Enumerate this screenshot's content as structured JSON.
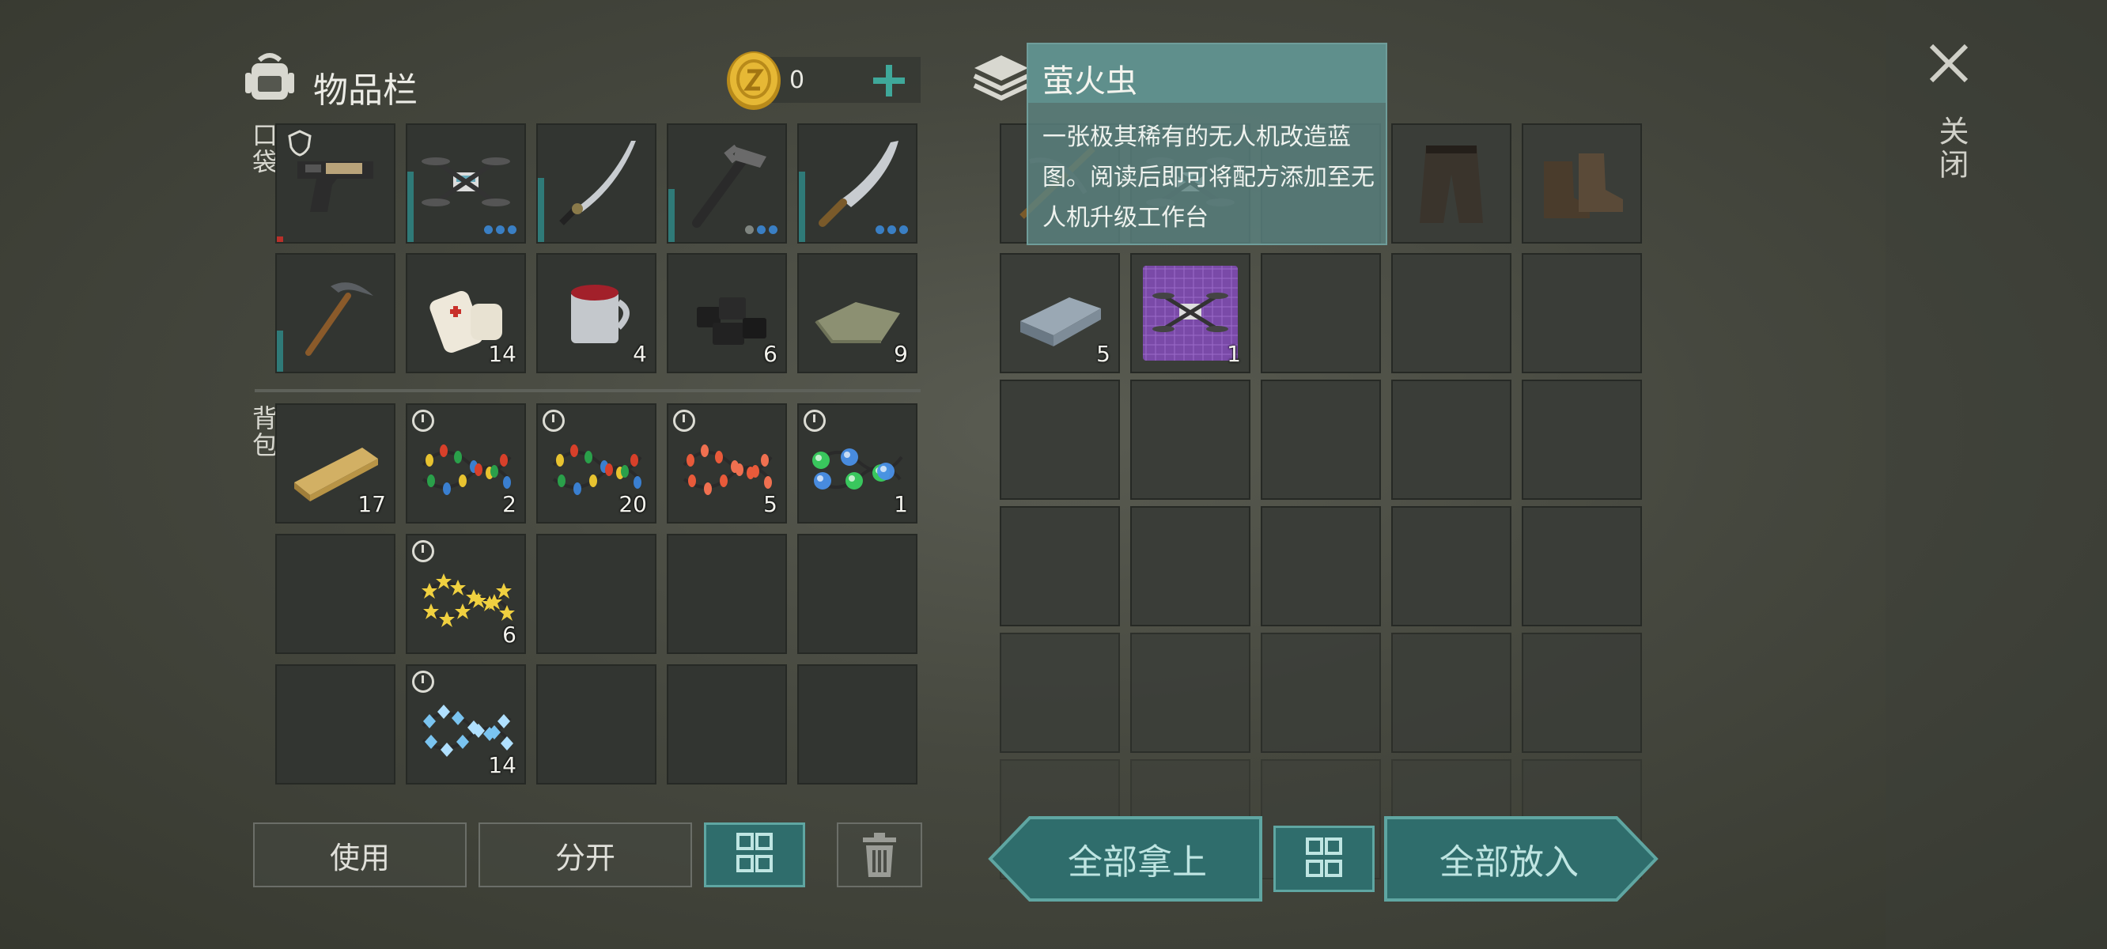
{
  "inventory": {
    "title": "物品栏",
    "coin_count": "0",
    "pocket_label": "口袋",
    "backpack_label": "背包",
    "pocket": [
      {
        "icon": "pistol-icon",
        "count": "",
        "durability": 0.05,
        "durability_color": "#b8302a",
        "dots": 0,
        "armor": true
      },
      {
        "icon": "drone-icon",
        "count": "",
        "durability": 0.6,
        "dots": 3
      },
      {
        "icon": "katana-icon",
        "count": "",
        "durability": 0.55,
        "dots": 0
      },
      {
        "icon": "hammer-icon",
        "count": "",
        "durability": 0.45,
        "dots": 2
      },
      {
        "icon": "machete-icon",
        "count": "",
        "durability": 0.6,
        "dots": 3
      },
      {
        "icon": "pickaxe-icon",
        "count": "",
        "durability": 0.35,
        "dots": 0
      },
      {
        "icon": "bandage-icon",
        "count": "14"
      },
      {
        "icon": "mug-icon",
        "count": "4"
      },
      {
        "icon": "coal-icon",
        "count": "6"
      },
      {
        "icon": "cloth-icon",
        "count": "9"
      }
    ],
    "backpack": [
      {
        "icon": "wood-plank-icon",
        "count": "17",
        "timer": false
      },
      {
        "icon": "christmas-lights-icon",
        "count": "2",
        "timer": true,
        "colors": [
          "#e8c330",
          "#d8402a",
          "#2aa04a",
          "#3a7fd0"
        ]
      },
      {
        "icon": "christmas-lights-icon",
        "count": "20",
        "timer": true,
        "colors": [
          "#e8c330",
          "#d8402a",
          "#2aa04a",
          "#3a7fd0"
        ]
      },
      {
        "icon": "red-lights-icon",
        "count": "5",
        "timer": true,
        "colors": [
          "#e85a3a",
          "#f07050"
        ]
      },
      {
        "icon": "glow-lights-icon",
        "count": "1",
        "timer": true,
        "colors": [
          "#3ad060",
          "#e8d040",
          "#4a90e8",
          "#e84a4a"
        ]
      },
      {
        "icon": "empty",
        "count": ""
      },
      {
        "icon": "star-lights-icon",
        "count": "6",
        "timer": true,
        "colors": [
          "#f0d040"
        ]
      },
      {
        "icon": "empty",
        "count": ""
      },
      {
        "icon": "empty",
        "count": ""
      },
      {
        "icon": "empty",
        "count": ""
      },
      {
        "icon": "empty",
        "count": ""
      },
      {
        "icon": "crystal-lights-icon",
        "count": "14",
        "timer": true,
        "colors": [
          "#7ac4f0",
          "#b0e0ff"
        ]
      },
      {
        "icon": "empty",
        "count": ""
      },
      {
        "icon": "empty",
        "count": ""
      },
      {
        "icon": "empty",
        "count": ""
      }
    ],
    "buttons": {
      "use": "使用",
      "split": "分开"
    }
  },
  "storage": {
    "items": [
      {
        "icon": "crossbow-icon",
        "count": ""
      },
      {
        "icon": "drone-icon",
        "count": ""
      },
      {
        "icon": "empty",
        "count": ""
      },
      {
        "icon": "pants-icon",
        "count": ""
      },
      {
        "icon": "boots-icon",
        "count": ""
      },
      {
        "icon": "iron-ingot-icon",
        "count": "5"
      },
      {
        "icon": "blueprint-icon",
        "count": "1"
      }
    ],
    "take_all": "全部拿上",
    "put_all": "全部放入"
  },
  "tooltip": {
    "title": "萤火虫",
    "description": "一张极其稀有的无人机改造蓝图。阅读后即可将配方添加至无人机升级工作台"
  },
  "close_label": "关闭",
  "colors": {
    "accent": "#2f6d6c",
    "accent_border": "#5fa6a2",
    "tooltip_bg": "#4f7b79"
  }
}
